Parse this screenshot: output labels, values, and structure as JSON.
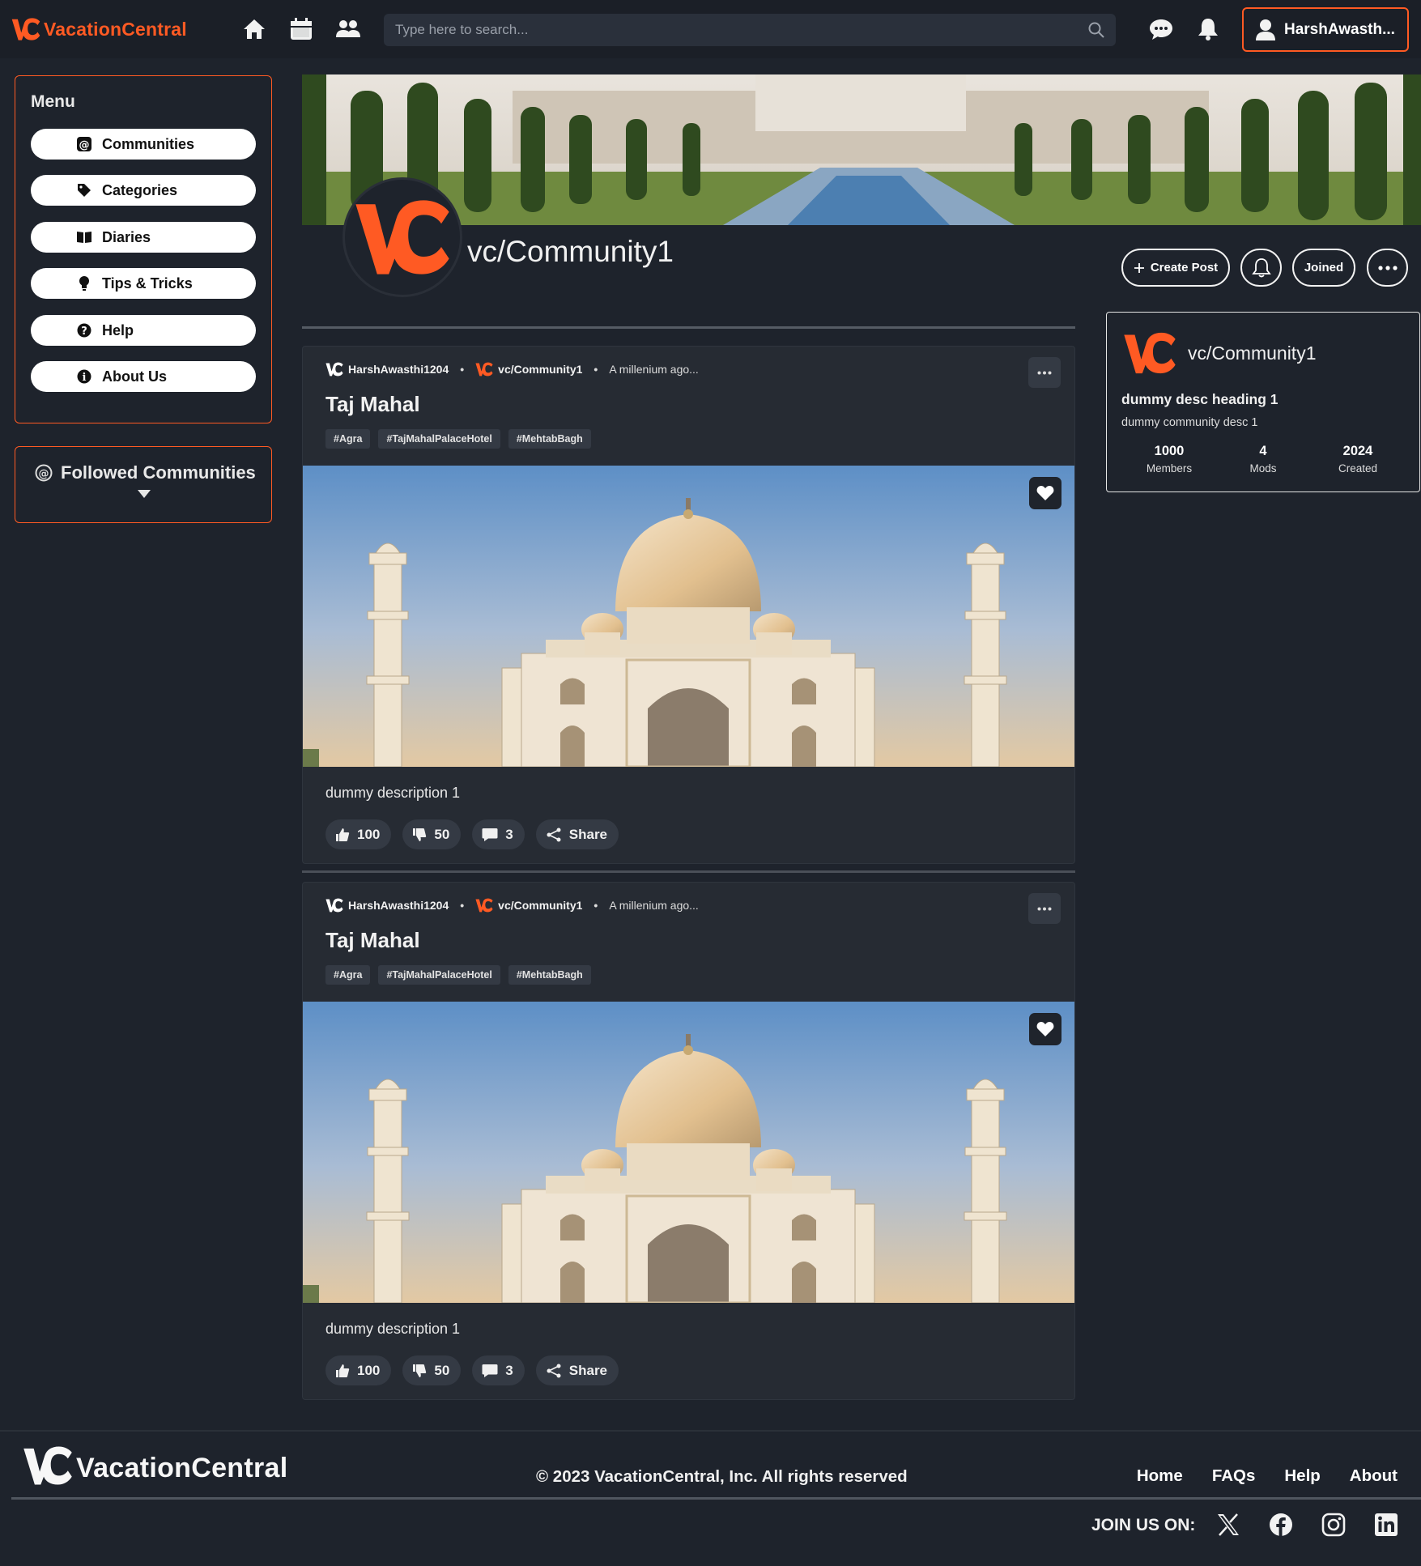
{
  "brand": {
    "name": "VacationCentral",
    "accent": "#ff5a23"
  },
  "navbar": {
    "icons": [
      "home-icon",
      "calendar-icon",
      "people-icon",
      "chat-icon",
      "bell-icon",
      "user-icon"
    ],
    "search_placeholder": "Type here to search...",
    "username": "HarshAwasth..."
  },
  "sidebar": {
    "title": "Menu",
    "items": [
      {
        "label": "Communities",
        "icon": "threads-icon"
      },
      {
        "label": "Categories",
        "icon": "tag-icon"
      },
      {
        "label": "Diaries",
        "icon": "book-icon"
      },
      {
        "label": "Tips & Tricks",
        "icon": "bulb-icon"
      },
      {
        "label": "Help",
        "icon": "question-icon"
      },
      {
        "label": "About Us",
        "icon": "info-icon"
      }
    ],
    "followed_title": "Followed Communities"
  },
  "community": {
    "name": "vc/Community1",
    "buttons": {
      "create_post": "Create Post",
      "joined": "Joined"
    }
  },
  "posts": [
    {
      "author": "HarshAwasthi1204",
      "community": "vc/Community1",
      "time": "A millenium ago...",
      "title": "Taj Mahal",
      "tags": [
        "#Agra",
        "#TajMahalPalaceHotel",
        "#MehtabBagh"
      ],
      "description": "dummy description 1",
      "likes": "100",
      "dislikes": "50",
      "comments": "3",
      "share": "Share"
    },
    {
      "author": "HarshAwasthi1204",
      "community": "vc/Community1",
      "time": "A millenium ago...",
      "title": "Taj Mahal",
      "tags": [
        "#Agra",
        "#TajMahalPalaceHotel",
        "#MehtabBagh"
      ],
      "description": "dummy description 1",
      "likes": "100",
      "dislikes": "50",
      "comments": "3",
      "share": "Share"
    }
  ],
  "about": {
    "name": "vc/Community1",
    "heading": "dummy desc heading 1",
    "desc": "dummy community desc 1",
    "stats": [
      {
        "value": "1000",
        "label": "Members"
      },
      {
        "value": "4",
        "label": "Mods"
      },
      {
        "value": "2024",
        "label": "Created"
      }
    ]
  },
  "footer": {
    "brand": "VacationCentral",
    "copyright": "© 2023 VacationCentral, Inc. All rights reserved",
    "links": [
      "Home",
      "FAQs",
      "Help",
      "About"
    ],
    "join": "JOIN US ON:",
    "socials": [
      "x-icon",
      "facebook-icon",
      "instagram-icon",
      "linkedin-icon"
    ]
  }
}
